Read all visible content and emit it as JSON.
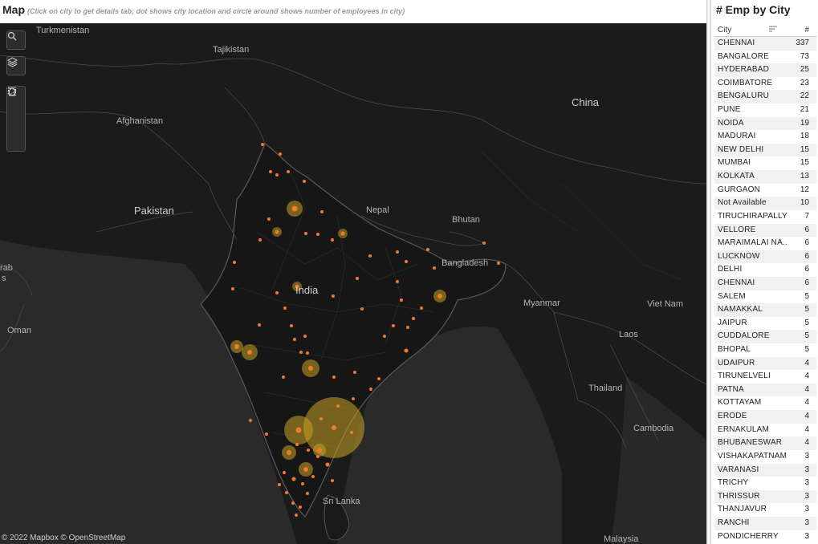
{
  "map": {
    "title": "Map",
    "subtitle": "(Click on city to get details  tab; dot shows city location and circle around shows number of employees in city)",
    "attribution": "© 2022 Mapbox  © OpenStreetMap",
    "labels": {
      "turkmenistan": "Turkmenistan",
      "tajikistan": "Tajikistan",
      "afghanistan": "Afghanistan",
      "pakistan": "Pakistan",
      "nepal": "Nepal",
      "bhutan": "Bhutan",
      "bangladesh": "Bangladesh",
      "india": "India",
      "china": "China",
      "myanmar": "Myanmar",
      "laos": "Laos",
      "vietnam": "Viet Nam",
      "thailand": "Thailand",
      "cambodia": "Cambodia",
      "sri_lanka": "Sri Lanka",
      "malaysia": "Malaysia",
      "oman": "Oman",
      "arabia_partial": "rab",
      "arabia_partial2": "s"
    },
    "tools": [
      "search-icon",
      "layers-icon",
      "home-icon",
      "rect-select-icon",
      "radial-select-icon",
      "lasso-icon"
    ],
    "colors": {
      "dot": "#f07a2e",
      "circle": "#c9a227",
      "land": "#1b1b1b",
      "sea": "#2a2a2a",
      "border": "#4a4a4a"
    }
  },
  "panel": {
    "title": "# Emp by City",
    "col_city": "City",
    "col_num": "#",
    "rows": [
      {
        "city": "CHENNAI",
        "count": "337"
      },
      {
        "city": "BANGALORE",
        "count": "73"
      },
      {
        "city": "HYDERABAD",
        "count": "25"
      },
      {
        "city": "COIMBATORE",
        "count": "23"
      },
      {
        "city": "BENGALURU",
        "count": "22"
      },
      {
        "city": "PUNE",
        "count": "21"
      },
      {
        "city": "NOIDA",
        "count": "19"
      },
      {
        "city": "MADURAI",
        "count": "18"
      },
      {
        "city": "NEW DELHI",
        "count": "15"
      },
      {
        "city": "MUMBAI",
        "count": "15"
      },
      {
        "city": "KOLKATA",
        "count": "13"
      },
      {
        "city": "GURGAON",
        "count": "12"
      },
      {
        "city": "Not Available",
        "count": "10"
      },
      {
        "city": "TIRUCHIRAPALLY",
        "count": "7"
      },
      {
        "city": "VELLORE",
        "count": "6"
      },
      {
        "city": "MARAIMALAI NA..",
        "count": "6"
      },
      {
        "city": "LUCKNOW",
        "count": "6"
      },
      {
        "city": "DELHI",
        "count": "6"
      },
      {
        "city": "CHENNAI",
        "count": "6"
      },
      {
        "city": "SALEM",
        "count": "5"
      },
      {
        "city": "NAMAKKAL",
        "count": "5"
      },
      {
        "city": "JAIPUR",
        "count": "5"
      },
      {
        "city": "CUDDALORE",
        "count": "5"
      },
      {
        "city": "BHOPAL",
        "count": "5"
      },
      {
        "city": "UDAIPUR",
        "count": "4"
      },
      {
        "city": "TIRUNELVELI",
        "count": "4"
      },
      {
        "city": "PATNA",
        "count": "4"
      },
      {
        "city": "KOTTAYAM",
        "count": "4"
      },
      {
        "city": "ERODE",
        "count": "4"
      },
      {
        "city": "ERNAKULAM",
        "count": "4"
      },
      {
        "city": "BHUBANESWAR",
        "count": "4"
      },
      {
        "city": "VISHAKAPATNAM",
        "count": "3"
      },
      {
        "city": "VARANASI",
        "count": "3"
      },
      {
        "city": "TRICHY",
        "count": "3"
      },
      {
        "city": "THRISSUR",
        "count": "3"
      },
      {
        "city": "THANJAVUR",
        "count": "3"
      },
      {
        "city": "RANCHI",
        "count": "3"
      },
      {
        "city": "PONDICHERRY",
        "count": "3"
      }
    ]
  }
}
